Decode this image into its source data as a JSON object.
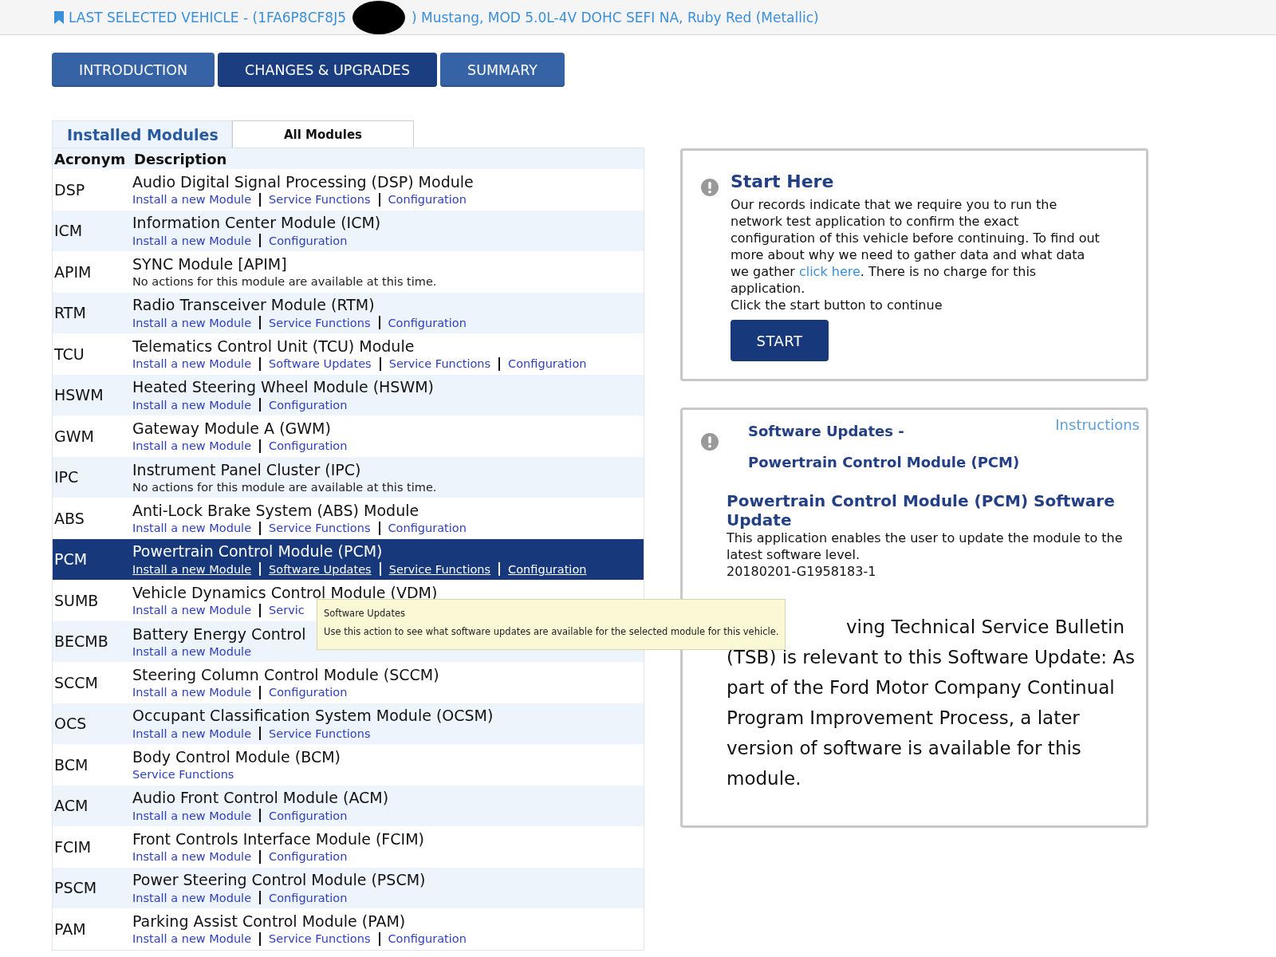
{
  "vehicle_bar": {
    "label_before": "LAST SELECTED VEHICLE - (1FA6P8CF8J5",
    "label_after": ") Mustang, MOD 5.0L-4V DOHC SEFI NA, Ruby Red (Metallic)"
  },
  "nav_tabs": [
    {
      "label": "INTRODUCTION",
      "selected": false
    },
    {
      "label": "CHANGES & UPGRADES",
      "selected": true
    },
    {
      "label": "SUMMARY",
      "selected": false
    }
  ],
  "module_tabs": [
    {
      "label": "Installed Modules",
      "selected": true
    },
    {
      "label": "All Modules",
      "selected": false
    }
  ],
  "table": {
    "columns": [
      "Acronym",
      "Description"
    ],
    "rows": [
      {
        "acronym": "DSP",
        "description": "Audio Digital Signal Processing (DSP) Module",
        "actions": [
          "Install a new Module",
          "Service Functions",
          "Configuration"
        ],
        "selected": false
      },
      {
        "acronym": "ICM",
        "description": "Information Center Module (ICM)",
        "actions": [
          "Install a new Module",
          "Configuration"
        ],
        "selected": false
      },
      {
        "acronym": "APIM",
        "description": "SYNC Module [APIM]",
        "note": "No actions for this module are available at this time.",
        "selected": false
      },
      {
        "acronym": "RTM",
        "description": "Radio Transceiver Module (RTM)",
        "actions": [
          "Install a new Module",
          "Service Functions",
          "Configuration"
        ],
        "selected": false
      },
      {
        "acronym": "TCU",
        "description": "Telematics Control Unit (TCU) Module",
        "actions": [
          "Install a new Module",
          "Software Updates",
          "Service Functions",
          "Configuration"
        ],
        "selected": false
      },
      {
        "acronym": "HSWM",
        "description": "Heated Steering Wheel Module (HSWM)",
        "actions": [
          "Install a new Module",
          "Configuration"
        ],
        "selected": false
      },
      {
        "acronym": "GWM",
        "description": "Gateway Module A (GWM)",
        "actions": [
          "Install a new Module",
          "Configuration"
        ],
        "selected": false
      },
      {
        "acronym": "IPC",
        "description": "Instrument Panel Cluster (IPC)",
        "note": "No actions for this module are available at this time.",
        "selected": false
      },
      {
        "acronym": "ABS",
        "description": "Anti-Lock Brake System (ABS) Module",
        "actions": [
          "Install a new Module",
          "Service Functions",
          "Configuration"
        ],
        "selected": false
      },
      {
        "acronym": "PCM",
        "description": "Powertrain Control Module (PCM)",
        "actions": [
          "Install a new Module",
          "Software Updates",
          "Service Functions",
          "Configuration"
        ],
        "selected": true
      },
      {
        "acronym": "SUMB",
        "description": "Vehicle Dynamics Control Module (VDM)",
        "actions": [
          "Install a new Module",
          "Servic"
        ],
        "selected": false
      },
      {
        "acronym": "BECMB",
        "description": "Battery Energy Control",
        "actions": [
          "Install a new Module"
        ],
        "selected": false
      },
      {
        "acronym": "SCCM",
        "description": "Steering Column Control Module (SCCM)",
        "actions": [
          "Install a new Module",
          "Configuration"
        ],
        "selected": false
      },
      {
        "acronym": "OCS",
        "description": "Occupant Classification System Module (OCSM)",
        "actions": [
          "Install a new Module",
          "Service Functions"
        ],
        "selected": false
      },
      {
        "acronym": "BCM",
        "description": "Body Control Module (BCM)",
        "actions": [
          "Service Functions"
        ],
        "selected": false
      },
      {
        "acronym": "ACM",
        "description": "Audio Front Control Module (ACM)",
        "actions": [
          "Install a new Module",
          "Configuration"
        ],
        "selected": false
      },
      {
        "acronym": "FCIM",
        "description": "Front Controls Interface Module (FCIM)",
        "actions": [
          "Install a new Module",
          "Configuration"
        ],
        "selected": false
      },
      {
        "acronym": "PSCM",
        "description": "Power Steering Control Module (PSCM)",
        "actions": [
          "Install a new Module",
          "Configuration"
        ],
        "selected": false
      },
      {
        "acronym": "PAM",
        "description": "Parking Assist Control Module (PAM)",
        "actions": [
          "Install a new Module",
          "Service Functions",
          "Configuration"
        ],
        "selected": false
      }
    ]
  },
  "tooltip": {
    "title": "Software Updates",
    "text": "Use this action to see what software updates are available for the selected module for this vehicle."
  },
  "start_panel": {
    "title": "Start Here",
    "text_before": "Our records indicate that we require you to run the network test application to confirm the exact configuration of this vehicle before continuing. To find out more about why we need to gather data and what data we gather ",
    "link": "click here",
    "text_after": ". There is no charge for this application.",
    "instruction": "Click the start button to continue",
    "button": "START"
  },
  "software_panel": {
    "title_line_1": "Software Updates -",
    "title_line_2": "Powertrain Control Module (PCM)",
    "instructions_link": "Instructions",
    "heading": "Powertrain Control Module (PCM) Software Update",
    "description": "This application enables the user to update the module to the latest software level.",
    "code": "20180201-G1958183-1",
    "tsb_first_line": "ving Technical Service Bulletin",
    "tsb_rest": "(TSB) is relevant to this Software Update: As part of the Ford Motor Company Continual Program Improvement Process, a later version of software is available for this module."
  }
}
